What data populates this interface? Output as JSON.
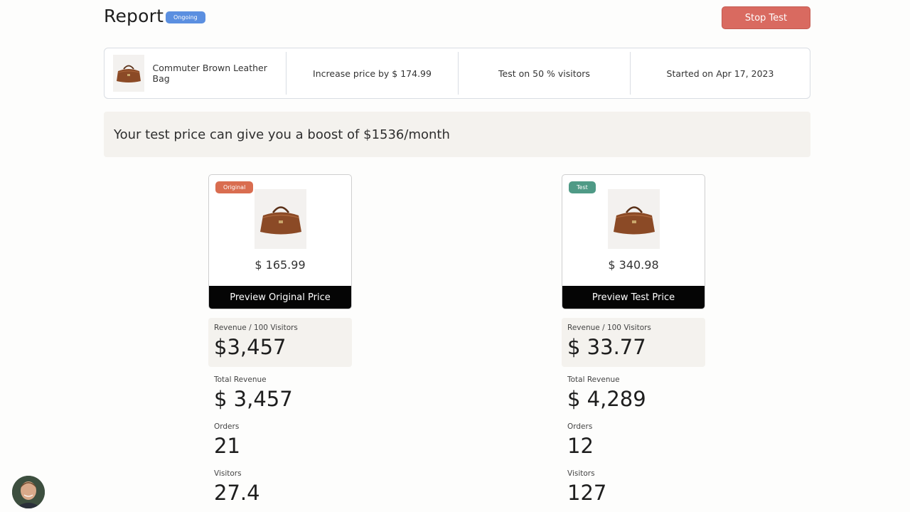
{
  "header": {
    "title": "Report",
    "status": "Ongoing",
    "stop_label": "Stop Test"
  },
  "summary": {
    "product_name": "Commuter Brown Leather Bag",
    "price_change": "Increase price by $ 174.99",
    "audience": "Test on 50 % visitors",
    "started": "Started on Apr 17, 2023"
  },
  "boost_message": "Your test price can give you a boost of $1536/month",
  "variants": [
    {
      "tag": "Original",
      "price": "$ 165.99",
      "preview_label": "Preview Original Price",
      "metrics": {
        "rev_per_100_label": "Revenue / 100 Visitors",
        "rev_per_100": "$3,457",
        "total_revenue_label": "Total Revenue",
        "total_revenue": "$ 3,457",
        "orders_label": "Orders",
        "orders": "21",
        "visitors_label": "Visitors",
        "visitors": "27.4"
      }
    },
    {
      "tag": "Test",
      "price": "$ 340.98",
      "preview_label": "Preview Test Price",
      "metrics": {
        "rev_per_100_label": "Revenue / 100 Visitors",
        "rev_per_100": "$ 33.77",
        "total_revenue_label": "Total Revenue",
        "total_revenue": "$ 4,289",
        "orders_label": "Orders",
        "orders": "12",
        "visitors_label": "Visitors",
        "visitors": "127"
      }
    }
  ],
  "colors": {
    "ongoing_badge": "#5b8fe0",
    "stop_button": "#d96a60",
    "original_tag": "#d96d50",
    "test_tag": "#4f9a86",
    "preview_button": "#050505",
    "banner_bg": "#f4f2ee"
  },
  "icons": {
    "product": "leather-bag-image",
    "avatar": "user-avatar"
  }
}
